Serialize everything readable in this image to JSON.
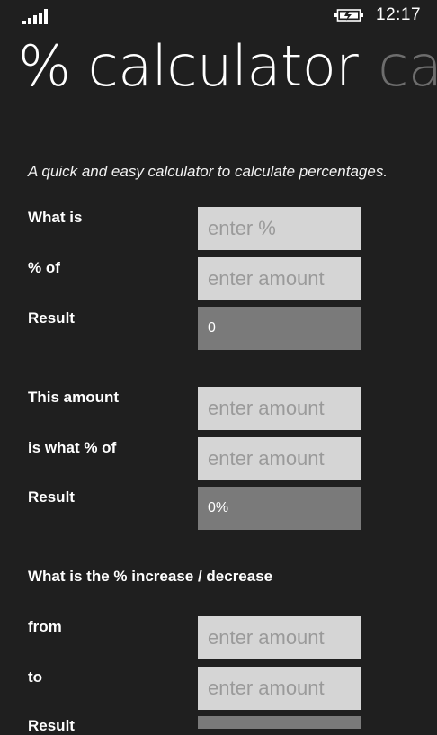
{
  "status_bar": {
    "signal_icon": "signal-strength-icon",
    "battery_icon": "battery-charging-icon",
    "time": "12:17"
  },
  "pivot": {
    "active_title": "% calculator",
    "next_title": "calc"
  },
  "intro_text": "A quick and easy calculator to calculate percentages.",
  "section1": {
    "what_is_label": "What is",
    "percent_placeholder": "enter %",
    "percent_of_label": "% of",
    "amount_placeholder": "enter amount",
    "result_label": "Result",
    "result_value": "0"
  },
  "section2": {
    "this_amount_label": "This amount",
    "amount_placeholder": "enter amount",
    "is_what_label": "is what % of",
    "total_placeholder": "enter amount",
    "result_label": "Result",
    "result_value": "0%"
  },
  "section3": {
    "heading": "What is the % increase / decrease",
    "from_label": "from",
    "from_placeholder": "enter amount",
    "to_label": "to",
    "to_placeholder": "enter amount",
    "result_label": "Result"
  },
  "colors": {
    "background": "#1f1f1f",
    "input_background": "#d5d5d5",
    "result_background": "#7a7a7a",
    "inactive_pivot": "#6d6d6d"
  }
}
